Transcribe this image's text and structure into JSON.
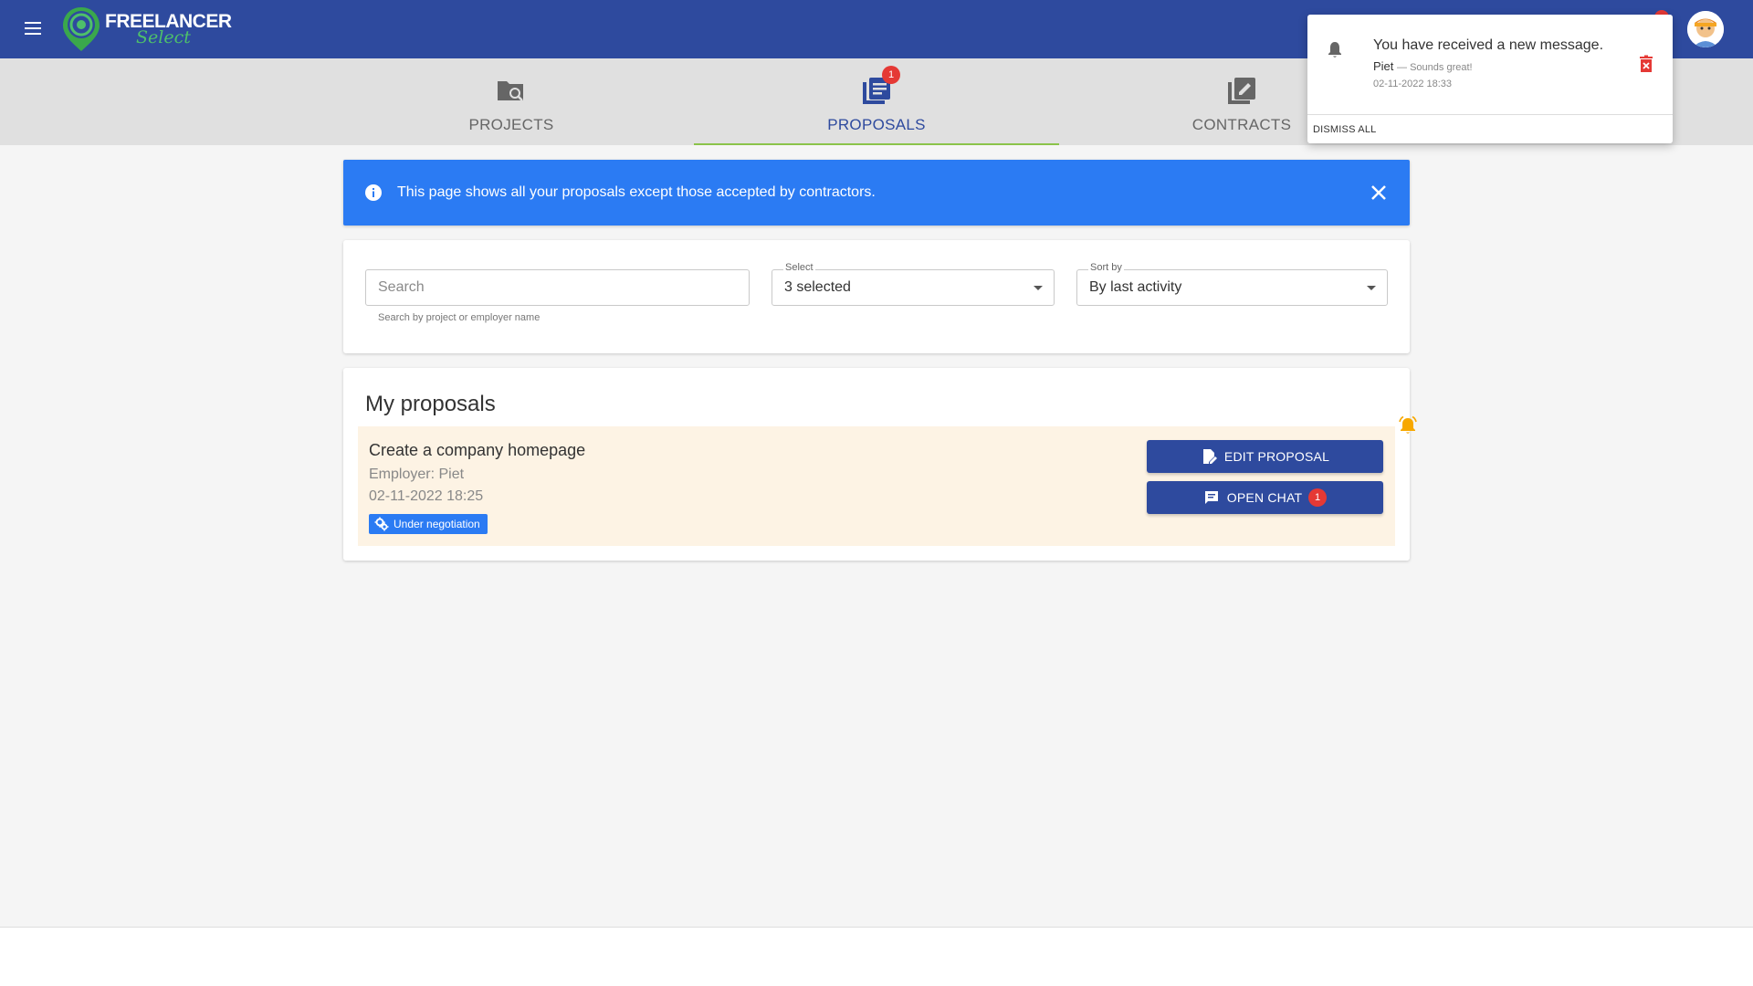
{
  "header": {
    "brand_main": "FREELANCER",
    "brand_sub": "Select",
    "menu_icon": "hamburger-menu-icon",
    "avatar_icon": "user-avatar"
  },
  "tabs": [
    {
      "label": "PROJECTS",
      "icon": "folder-search-icon",
      "active": false
    },
    {
      "label": "PROPOSALS",
      "icon": "document-list-icon",
      "active": true,
      "badge": "1"
    },
    {
      "label": "CONTRACTS",
      "icon": "edit-document-icon",
      "active": false
    }
  ],
  "info_banner": {
    "text": "This page shows all your proposals except those accepted by contractors.",
    "icon": "info-icon",
    "color": "#2b7bf3"
  },
  "filters": {
    "search_placeholder": "Search",
    "search_hint": "Search by project or employer name",
    "select_label": "Select",
    "select_value": "3 selected",
    "sort_label": "Sort by",
    "sort_value": "By last activity"
  },
  "proposals": {
    "title": "My proposals",
    "items": [
      {
        "title": "Create a company homepage",
        "employer": "Employer: Piet",
        "date": "02-11-2022 18:25",
        "status": "Under negotiation",
        "edit_label": "EDIT PROPOSAL",
        "chat_label": "OPEN CHAT",
        "chat_badge": "1"
      }
    ]
  },
  "notification": {
    "title": "You have received a new message.",
    "sender": "Piet",
    "message": "— Sounds great!",
    "time": "02-11-2022 18:33",
    "dismiss_label": "DISMISS ALL"
  },
  "colors": {
    "primary": "#2e4a9e",
    "accent_green": "#8bc34a",
    "badge_red": "#e53935",
    "proposal_bg": "#fdf3e4"
  }
}
